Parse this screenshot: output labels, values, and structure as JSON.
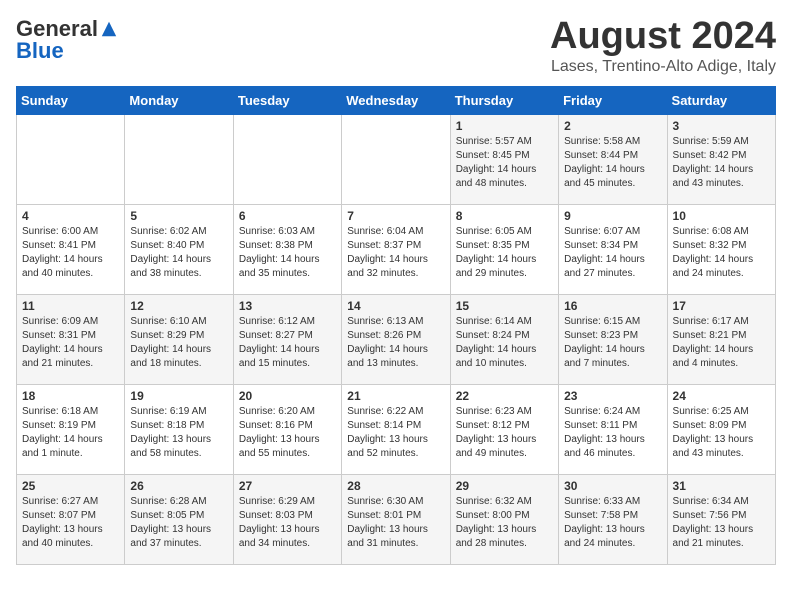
{
  "logo": {
    "general": "General",
    "blue": "Blue"
  },
  "title": "August 2024",
  "location": "Lases, Trentino-Alto Adige, Italy",
  "days_of_week": [
    "Sunday",
    "Monday",
    "Tuesday",
    "Wednesday",
    "Thursday",
    "Friday",
    "Saturday"
  ],
  "weeks": [
    [
      {
        "day": "",
        "info": ""
      },
      {
        "day": "",
        "info": ""
      },
      {
        "day": "",
        "info": ""
      },
      {
        "day": "",
        "info": ""
      },
      {
        "day": "1",
        "info": "Sunrise: 5:57 AM\nSunset: 8:45 PM\nDaylight: 14 hours\nand 48 minutes."
      },
      {
        "day": "2",
        "info": "Sunrise: 5:58 AM\nSunset: 8:44 PM\nDaylight: 14 hours\nand 45 minutes."
      },
      {
        "day": "3",
        "info": "Sunrise: 5:59 AM\nSunset: 8:42 PM\nDaylight: 14 hours\nand 43 minutes."
      }
    ],
    [
      {
        "day": "4",
        "info": "Sunrise: 6:00 AM\nSunset: 8:41 PM\nDaylight: 14 hours\nand 40 minutes."
      },
      {
        "day": "5",
        "info": "Sunrise: 6:02 AM\nSunset: 8:40 PM\nDaylight: 14 hours\nand 38 minutes."
      },
      {
        "day": "6",
        "info": "Sunrise: 6:03 AM\nSunset: 8:38 PM\nDaylight: 14 hours\nand 35 minutes."
      },
      {
        "day": "7",
        "info": "Sunrise: 6:04 AM\nSunset: 8:37 PM\nDaylight: 14 hours\nand 32 minutes."
      },
      {
        "day": "8",
        "info": "Sunrise: 6:05 AM\nSunset: 8:35 PM\nDaylight: 14 hours\nand 29 minutes."
      },
      {
        "day": "9",
        "info": "Sunrise: 6:07 AM\nSunset: 8:34 PM\nDaylight: 14 hours\nand 27 minutes."
      },
      {
        "day": "10",
        "info": "Sunrise: 6:08 AM\nSunset: 8:32 PM\nDaylight: 14 hours\nand 24 minutes."
      }
    ],
    [
      {
        "day": "11",
        "info": "Sunrise: 6:09 AM\nSunset: 8:31 PM\nDaylight: 14 hours\nand 21 minutes."
      },
      {
        "day": "12",
        "info": "Sunrise: 6:10 AM\nSunset: 8:29 PM\nDaylight: 14 hours\nand 18 minutes."
      },
      {
        "day": "13",
        "info": "Sunrise: 6:12 AM\nSunset: 8:27 PM\nDaylight: 14 hours\nand 15 minutes."
      },
      {
        "day": "14",
        "info": "Sunrise: 6:13 AM\nSunset: 8:26 PM\nDaylight: 14 hours\nand 13 minutes."
      },
      {
        "day": "15",
        "info": "Sunrise: 6:14 AM\nSunset: 8:24 PM\nDaylight: 14 hours\nand 10 minutes."
      },
      {
        "day": "16",
        "info": "Sunrise: 6:15 AM\nSunset: 8:23 PM\nDaylight: 14 hours\nand 7 minutes."
      },
      {
        "day": "17",
        "info": "Sunrise: 6:17 AM\nSunset: 8:21 PM\nDaylight: 14 hours\nand 4 minutes."
      }
    ],
    [
      {
        "day": "18",
        "info": "Sunrise: 6:18 AM\nSunset: 8:19 PM\nDaylight: 14 hours\nand 1 minute."
      },
      {
        "day": "19",
        "info": "Sunrise: 6:19 AM\nSunset: 8:18 PM\nDaylight: 13 hours\nand 58 minutes."
      },
      {
        "day": "20",
        "info": "Sunrise: 6:20 AM\nSunset: 8:16 PM\nDaylight: 13 hours\nand 55 minutes."
      },
      {
        "day": "21",
        "info": "Sunrise: 6:22 AM\nSunset: 8:14 PM\nDaylight: 13 hours\nand 52 minutes."
      },
      {
        "day": "22",
        "info": "Sunrise: 6:23 AM\nSunset: 8:12 PM\nDaylight: 13 hours\nand 49 minutes."
      },
      {
        "day": "23",
        "info": "Sunrise: 6:24 AM\nSunset: 8:11 PM\nDaylight: 13 hours\nand 46 minutes."
      },
      {
        "day": "24",
        "info": "Sunrise: 6:25 AM\nSunset: 8:09 PM\nDaylight: 13 hours\nand 43 minutes."
      }
    ],
    [
      {
        "day": "25",
        "info": "Sunrise: 6:27 AM\nSunset: 8:07 PM\nDaylight: 13 hours\nand 40 minutes."
      },
      {
        "day": "26",
        "info": "Sunrise: 6:28 AM\nSunset: 8:05 PM\nDaylight: 13 hours\nand 37 minutes."
      },
      {
        "day": "27",
        "info": "Sunrise: 6:29 AM\nSunset: 8:03 PM\nDaylight: 13 hours\nand 34 minutes."
      },
      {
        "day": "28",
        "info": "Sunrise: 6:30 AM\nSunset: 8:01 PM\nDaylight: 13 hours\nand 31 minutes."
      },
      {
        "day": "29",
        "info": "Sunrise: 6:32 AM\nSunset: 8:00 PM\nDaylight: 13 hours\nand 28 minutes."
      },
      {
        "day": "30",
        "info": "Sunrise: 6:33 AM\nSunset: 7:58 PM\nDaylight: 13 hours\nand 24 minutes."
      },
      {
        "day": "31",
        "info": "Sunrise: 6:34 AM\nSunset: 7:56 PM\nDaylight: 13 hours\nand 21 minutes."
      }
    ]
  ]
}
